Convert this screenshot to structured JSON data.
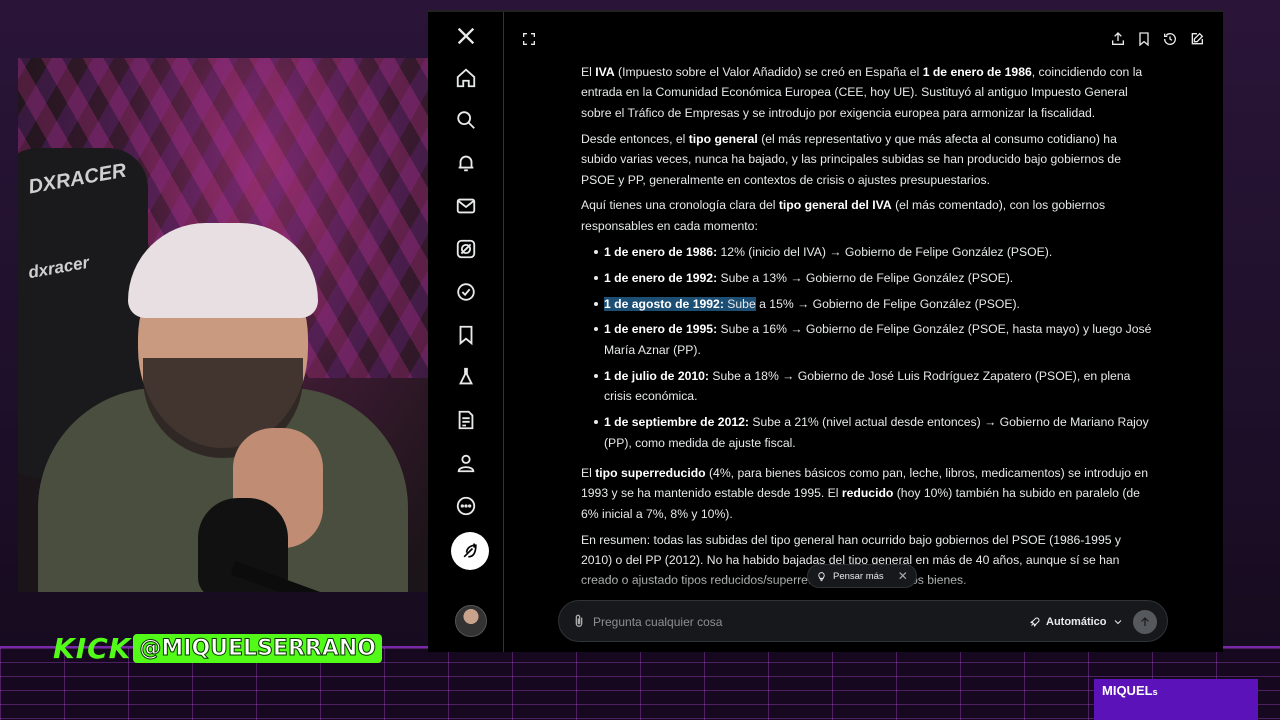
{
  "stream": {
    "kick_logo": "KICK",
    "kick_handle": "@MIQUELSERRANO",
    "corner_badge": "MIQUEL",
    "corner_badge_suffix": "s",
    "chair_brand_1": "DXRACER",
    "chair_brand_2": "dxracer"
  },
  "colors": {
    "kick_green": "#53fc18",
    "badge_purple": "#5b12b8",
    "highlight": "#1d4e74",
    "x_background": "#000000"
  },
  "sidebar": {
    "items": [
      {
        "icon": "x-logo-icon"
      },
      {
        "icon": "home-icon"
      },
      {
        "icon": "search-icon"
      },
      {
        "icon": "bell-icon"
      },
      {
        "icon": "mail-icon"
      },
      {
        "icon": "grok-icon"
      },
      {
        "icon": "verified-icon"
      },
      {
        "icon": "bookmark-icon"
      },
      {
        "icon": "flask-icon"
      },
      {
        "icon": "compose-list-icon"
      },
      {
        "icon": "profile-icon"
      },
      {
        "icon": "more-icon"
      }
    ]
  },
  "toolbar": {
    "icons": [
      "expand-icon",
      "share-icon",
      "bookmark-icon",
      "history-icon",
      "new-chat-icon"
    ]
  },
  "response": {
    "p1_a": "El ",
    "p1_b": "IVA",
    "p1_c": " (Impuesto sobre el Valor Añadido) se creó en España el ",
    "p1_d": "1 de enero de 1986",
    "p1_e": ", coincidiendo con la entrada en la Comunidad Económica Europea (CEE, hoy UE). Sustituyó al antiguo Impuesto General sobre el Tráfico de Empresas y se introdujo por exigencia europea para armonizar la fiscalidad.",
    "p2_a": "Desde entonces, el ",
    "p2_b": "tipo general",
    "p2_c": " (el más representativo y que más afecta al consumo cotidiano) ha subido varias veces, nunca ha bajado, y las principales subidas se han producido bajo gobiernos de PSOE y PP, generalmente en contextos de crisis o ajustes presupuestarios.",
    "p3_a": "Aquí tienes una cronología clara del ",
    "p3_b": "tipo general del IVA",
    "p3_c": " (el más comentado), con los gobiernos responsables en cada momento:",
    "timeline": [
      {
        "date": "1 de enero de 1986:",
        "text": " 12% (inicio del IVA) → Gobierno de Felipe González (PSOE)."
      },
      {
        "date": "1 de enero de 1992:",
        "text": " Sube a 13% → Gobierno de Felipe González (PSOE)."
      },
      {
        "date": "1 de agosto de 1992:",
        "text_hl": " Sube",
        "text": " a 15% → Gobierno de Felipe González (PSOE)."
      },
      {
        "date": "1 de enero de 1995:",
        "text": " Sube a 16% → Gobierno de Felipe González (PSOE, hasta mayo) y luego José María Aznar (PP)."
      },
      {
        "date": "1 de julio de 2010:",
        "text": " Sube a 18% → Gobierno de José Luis Rodríguez Zapatero (PSOE), en plena crisis económica."
      },
      {
        "date": "1 de septiembre de 2012:",
        "text": " Sube a 21% (nivel actual desde entonces) → Gobierno de Mariano Rajoy (PP), como medida de ajuste fiscal."
      }
    ],
    "p4_a": "El ",
    "p4_b": "tipo superreducido",
    "p4_c": " (4%, para bienes básicos como pan, leche, libros, medicamentos) se introdujo en 1993 y se ha mantenido estable desde 1995. El ",
    "p4_d": "reducido",
    "p4_e": " (hoy 10%) también ha subido en paralelo (de 6% inicial a 7%, 8% y 10%).",
    "p5": "En resumen: todas las subidas del tipo general han ocurrido bajo gobiernos del PSOE (1986-1995 y 2010) o del PP (2012). No ha habido bajadas del tipo general en más de 40 años, aunque sí se han creado o ajustado tipos reducidos/superreducidos para algunos bienes."
  },
  "think_pill": {
    "label": "Pensar más",
    "close": "✕"
  },
  "composer": {
    "placeholder": "Pregunta cualquier cosa",
    "mode_label": "Automático"
  }
}
